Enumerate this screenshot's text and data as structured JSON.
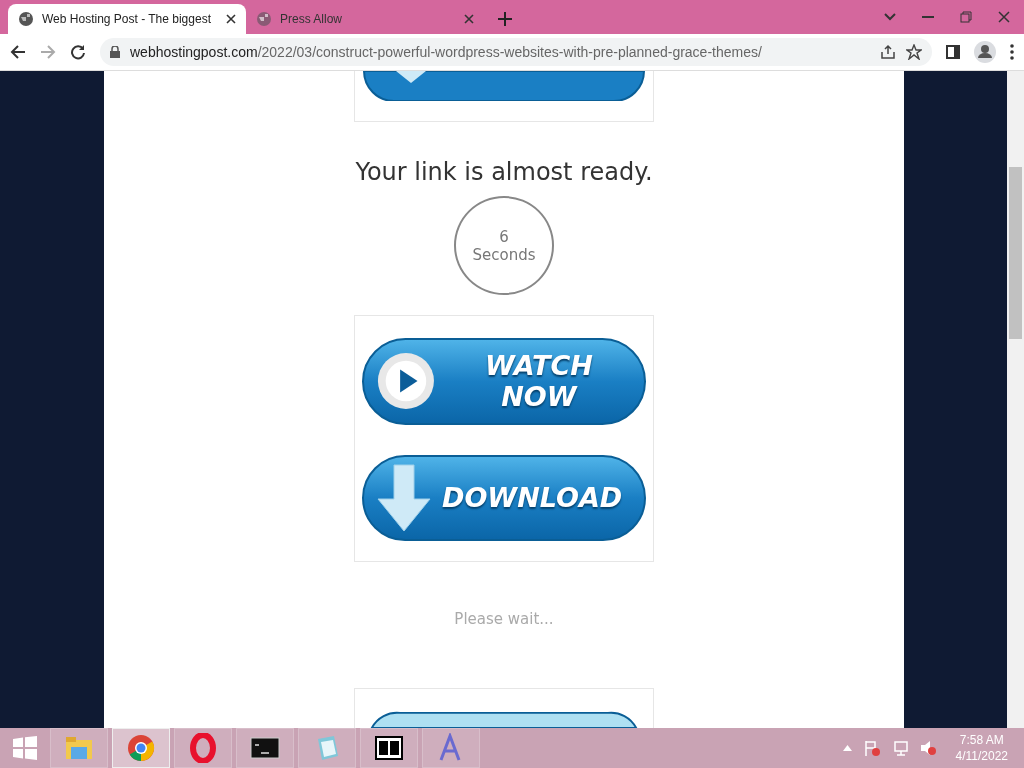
{
  "tabs": [
    {
      "title": "Web Hosting Post - The biggest",
      "selected": true
    },
    {
      "title": "Press Allow",
      "selected": false
    }
  ],
  "address": {
    "domain": "webhostingpost.com",
    "path": "/2022/03/construct-powerful-wordpress-websites-with-pre-planned-grace-themes/"
  },
  "page": {
    "heading": "Your link is almost ready.",
    "countdown": {
      "number": "6",
      "unit": "Seconds"
    },
    "buttons": [
      {
        "kind": "watch",
        "label": "WATCH NOW"
      },
      {
        "kind": "download",
        "label": "DOWNLOAD"
      }
    ],
    "wait_text": "Please wait..."
  },
  "taskbar": {
    "apps": [
      {
        "kind": "folder",
        "selected": false
      },
      {
        "kind": "chrome",
        "selected": true
      },
      {
        "kind": "opera",
        "selected": false
      },
      {
        "kind": "terminal",
        "selected": false
      },
      {
        "kind": "notepad",
        "selected": false
      },
      {
        "kind": "sevenzip",
        "selected": false
      },
      {
        "kind": "font",
        "selected": false
      }
    ],
    "time": "7:58 AM",
    "date": "4/11/2022"
  }
}
